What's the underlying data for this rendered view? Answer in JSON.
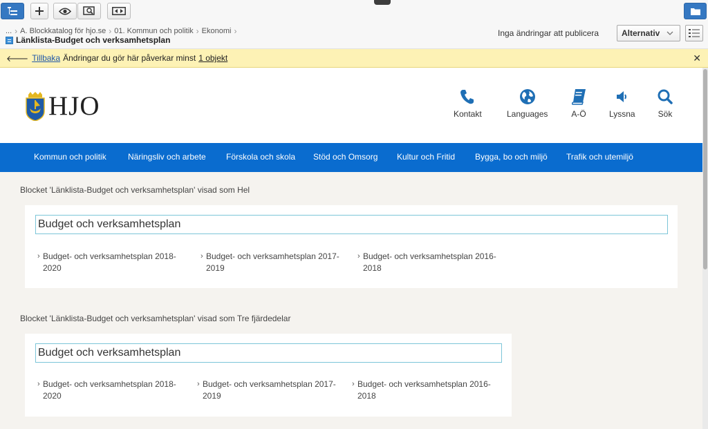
{
  "toolbar": {
    "breadcrumb": [
      "...",
      "A. Blockkatalog för hjo.se",
      "01. Kommun och politik",
      "Ekonomi"
    ],
    "page_title": "Länklista-Budget och verksamhetsplan",
    "publish_status": "Inga ändringar att publicera",
    "alternatives_label": "Alternativ"
  },
  "notice": {
    "back_label": "Tillbaka",
    "message": "Ändringar du gör här påverkar minst",
    "count_link": "1 objekt"
  },
  "site": {
    "logo_text": "HJO",
    "tools": [
      {
        "label": "Kontakt",
        "icon": "phone-icon"
      },
      {
        "label": "Languages",
        "icon": "globe-icon"
      },
      {
        "label": "A-Ö",
        "icon": "book-icon"
      },
      {
        "label": "Lyssna",
        "icon": "speaker-icon"
      },
      {
        "label": "Sök",
        "icon": "search-icon"
      }
    ],
    "nav": [
      "Kommun och politik",
      "Näringsliv och arbete",
      "Förskola och skola",
      "Stöd och Omsorg",
      "Kultur och Fritid",
      "Bygga, bo och miljö",
      "Trafik och utemiljö"
    ]
  },
  "blocks": [
    {
      "label": "Blocket 'Länklista-Budget och verksamhetsplan' visad som Hel",
      "heading": "Budget och verksamhetsplan",
      "links": [
        [
          "Budget- och verksamhetsplan 2018-",
          "2020"
        ],
        [
          "Budget- och verksamhetsplan 2017-",
          "2019"
        ],
        [
          "Budget- och verksamhetsplan 2016-",
          "2018"
        ]
      ]
    },
    {
      "label": "Blocket 'Länklista-Budget och verksamhetsplan' visad som Tre fjärdedelar",
      "heading": "Budget och verksamhetsplan",
      "links": [
        [
          "Budget- och verksamhetsplan 2018-",
          "2020"
        ],
        [
          "Budget- och verksamhetsplan 2017-",
          "2019"
        ],
        [
          "Budget- och verksamhetsplan 2016-",
          "2018"
        ]
      ]
    }
  ],
  "colors": {
    "nav_blue": "#0a6ccf",
    "icon_blue": "#1f6fb5",
    "notice_yellow": "#fdf2b5",
    "heading_border": "#7bc5d8"
  }
}
